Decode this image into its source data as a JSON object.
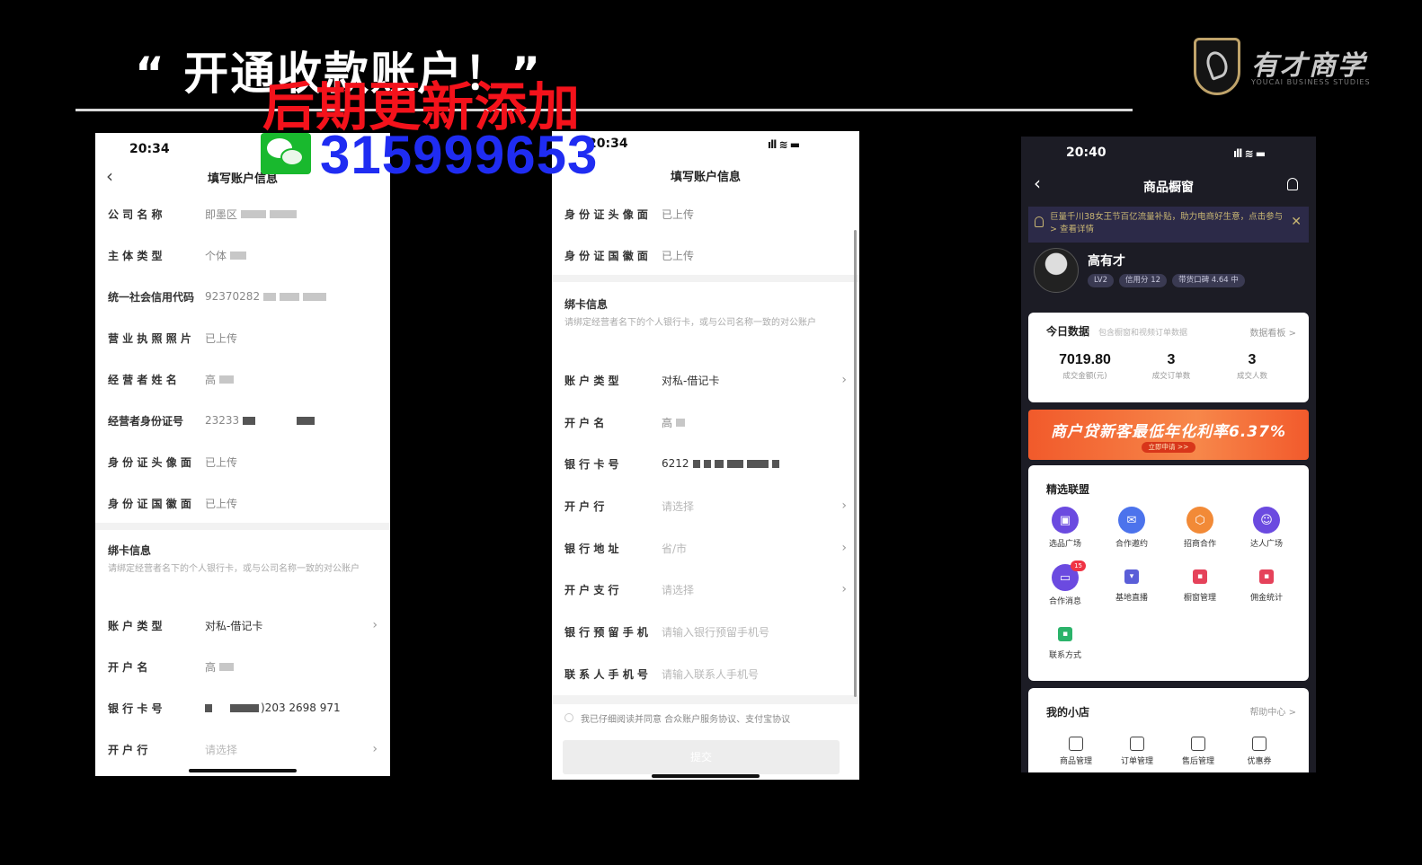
{
  "slide": {
    "title": "“ 开通收款账户！”",
    "overlay_text": "后期更新添加",
    "overlay_number": "315999653"
  },
  "logo": {
    "name": "有才商学",
    "subtitle": "YOUCAI BUSINESS STUDIES"
  },
  "phone1": {
    "time": "20:34",
    "signal": "▪▪▪",
    "title": "填写账户信息",
    "rows": [
      {
        "label": "公 司 名 称",
        "value": "即墨区"
      },
      {
        "label": "主 体 类 型",
        "value": "个体"
      },
      {
        "label": "统一社会信用代码",
        "value": "92370282"
      },
      {
        "label": "营 业 执 照 照 片",
        "value": "已上传"
      },
      {
        "label": "经 营 者 姓 名",
        "value": "高"
      },
      {
        "label": "经营者身份证号",
        "value": "23233"
      },
      {
        "label": "身 份 证 头 像 面",
        "value": "已上传"
      },
      {
        "label": "身 份 证 国 徽 面",
        "value": "已上传"
      }
    ],
    "bind_section_title": "绑卡信息",
    "bind_section_desc": "请绑定经营者名下的个人银行卡，或与公司名称一致的对公账户",
    "bind_rows": [
      {
        "label": "账 户 类 型",
        "value": "对私-借记卡"
      },
      {
        "label": "开 户 名",
        "value": "高"
      },
      {
        "label": "银 行 卡 号",
        "value": ")203 2698 971"
      },
      {
        "label": "开 户 行",
        "value": "请选择"
      }
    ]
  },
  "phone2": {
    "time": "20:34",
    "title": "填写账户信息",
    "rows": [
      {
        "label": "身 份 证 头 像 面",
        "value": "已上传"
      },
      {
        "label": "身 份 证 国 徽 面",
        "value": "已上传"
      }
    ],
    "bind_section_title": "绑卡信息",
    "bind_section_desc": "请绑定经营者名下的个人银行卡，或与公司名称一致的对公账户",
    "bind_rows": [
      {
        "label": "账 户 类 型",
        "value": "对私-借记卡"
      },
      {
        "label": "开 户 名",
        "value": "高"
      },
      {
        "label": "银 行 卡 号",
        "value": "6212"
      },
      {
        "label": "开 户 行",
        "value": "请选择"
      },
      {
        "label": "银 行 地 址",
        "value": "省/市"
      },
      {
        "label": "开 户 支 行",
        "value": "请选择"
      },
      {
        "label": "银 行 预 留 手 机",
        "value": "请输入银行预留手机号"
      },
      {
        "label": "联 系 人 手 机 号",
        "value": "请输入联系人手机号"
      }
    ],
    "agreement": "我已仔细阅读并同意 合众账户服务协议、支付宝协议",
    "submit": "提交"
  },
  "phone3": {
    "time": "20:40",
    "title": "商品橱窗",
    "notice": "巨量千川38女王节百亿流量补贴，助力电商好生意，点击参与> 查看详情",
    "user_name": "高有才",
    "badges": [
      "LV2",
      "信用分 12",
      "带货口碑 4.64 中"
    ],
    "today": {
      "title": "今日数据",
      "subtitle": "包含橱窗和视频订单数据",
      "link": "数据看板 >",
      "stats": [
        {
          "value": "7019.80",
          "caption": "成交金额(元)"
        },
        {
          "value": "3",
          "caption": "成交订单数"
        },
        {
          "value": "3",
          "caption": "成交人数"
        }
      ]
    },
    "promo": {
      "title": "商户贷新客最低年化利率6.37%",
      "button": "立即申请 >>"
    },
    "union": {
      "title": "精选联盟",
      "items": [
        {
          "label": "选品广场",
          "color": "#6b4ae0"
        },
        {
          "label": "合作邀约",
          "color": "#4c73ec"
        },
        {
          "label": "招商合作",
          "color": "#f28a37"
        },
        {
          "label": "达人广场",
          "color": "#6b4ae0"
        },
        {
          "label": "合作消息",
          "color": "#6b4ae0",
          "badge": "15"
        },
        {
          "label": "基地直播",
          "color": "#5a5ed8"
        },
        {
          "label": "橱窗管理",
          "color": "#e5425a"
        },
        {
          "label": "佣金统计",
          "color": "#e5425a"
        },
        {
          "label": "联系方式",
          "color": "#2bb36a"
        }
      ]
    },
    "shop": {
      "title": "我的小店",
      "link": "帮助中心 >",
      "tools": [
        "商品管理",
        "订单管理",
        "售后管理",
        "优惠券"
      ]
    }
  }
}
